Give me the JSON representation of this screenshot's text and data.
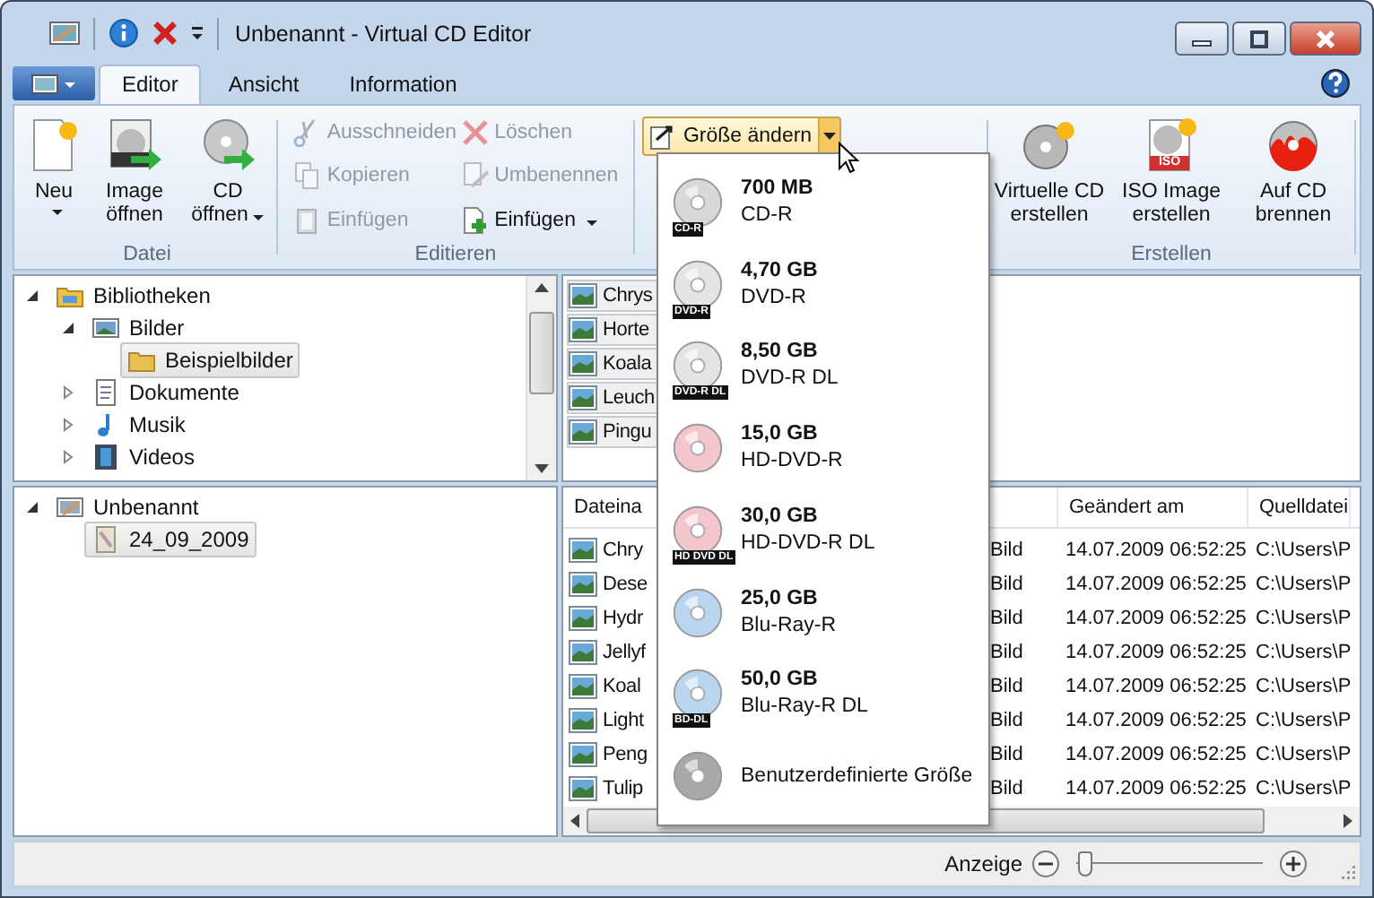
{
  "window": {
    "title": "Unbenannt - Virtual CD Editor"
  },
  "tabs": [
    {
      "label": "Editor",
      "selected": true
    },
    {
      "label": "Ansicht",
      "selected": false
    },
    {
      "label": "Information",
      "selected": false
    }
  ],
  "ribbon": {
    "datei": {
      "label": "Datei",
      "buttons": [
        {
          "kind": "new",
          "label": "Neu",
          "dropdown": true
        },
        {
          "kind": "image",
          "label": "Image öffnen",
          "dropdown": false
        },
        {
          "kind": "cd",
          "label": "CD öffnen",
          "dropdown": true
        }
      ]
    },
    "editieren": {
      "label": "Editieren",
      "buttons": [
        {
          "kind": "cut",
          "label": "Ausschneiden",
          "disabled": true,
          "dropdown": false
        },
        {
          "kind": "delete",
          "label": "Löschen",
          "disabled": true,
          "dropdown": false
        },
        {
          "kind": "copy",
          "label": "Kopieren",
          "disabled": true,
          "dropdown": false
        },
        {
          "kind": "rename",
          "label": "Umbenennen",
          "disabled": true,
          "dropdown": false
        },
        {
          "kind": "paste",
          "label": "Einfügen",
          "disabled": true,
          "dropdown": false
        },
        {
          "kind": "add",
          "label": "Einfügen",
          "disabled": false,
          "dropdown": true
        }
      ]
    },
    "resize": {
      "label": "Größe ändern",
      "expanded": true
    },
    "erstellen": {
      "label": "Erstellen",
      "buttons": [
        {
          "kind": "virtual",
          "label": "Virtuelle CD erstellen"
        },
        {
          "kind": "iso",
          "label": "ISO Image erstellen",
          "badge": "ISO"
        },
        {
          "kind": "burn",
          "label": "Auf CD brennen"
        }
      ]
    }
  },
  "size_menu": [
    {
      "kind": "cd",
      "size": "700 MB",
      "label": "CD-R",
      "badge": "CD-R"
    },
    {
      "kind": "dvd",
      "size": "4,70 GB",
      "label": "DVD-R",
      "badge": "DVD-R"
    },
    {
      "kind": "dvd",
      "size": "8,50 GB",
      "label": "DVD-R DL",
      "badge": "DVD-R DL"
    },
    {
      "kind": "hddvd",
      "size": "15,0 GB",
      "label": "HD-DVD-R"
    },
    {
      "kind": "hddvd",
      "size": "30,0 GB",
      "label": "HD-DVD-R DL",
      "badge": "HD DVD DL"
    },
    {
      "kind": "bluray",
      "size": "25,0 GB",
      "label": "Blu-Ray-R"
    },
    {
      "kind": "bluray",
      "size": "50,0 GB",
      "label": "Blu-Ray-R DL",
      "badge": "BD-DL"
    },
    {
      "kind": "custom",
      "label": "Benutzerdefinierte Größe"
    }
  ],
  "library_tree": [
    {
      "kind": "library",
      "label": "Bibliotheken",
      "expanded": true,
      "selected": false,
      "children": [
        {
          "kind": "pictures",
          "label": "Bilder",
          "expanded": true,
          "selected": false,
          "children": [
            {
              "kind": "folder",
              "label": "Beispielbilder",
              "selected": true
            }
          ]
        },
        {
          "kind": "documents",
          "label": "Dokumente",
          "expanded": false,
          "selected": false
        },
        {
          "kind": "music",
          "label": "Musik",
          "expanded": false,
          "selected": false
        },
        {
          "kind": "videos",
          "label": "Videos",
          "expanded": false,
          "selected": false
        }
      ]
    }
  ],
  "project_tree": [
    {
      "kind": "project",
      "label": "Unbenannt",
      "expanded": true,
      "selected": false,
      "children": [
        {
          "kind": "disc",
          "label": "24_09_2009",
          "selected": true
        }
      ]
    }
  ],
  "file_icons": [
    "Chrys",
    "Horte",
    "Koala",
    "Leuch",
    "Pingu"
  ],
  "table": {
    "columns": [
      "Dateina",
      "Geändert am",
      "Quelldatei"
    ],
    "rows": [
      {
        "name": "Chry",
        "type": "Bild",
        "modified": "14.07.2009 06:52:25",
        "source": "C:\\Users\\P"
      },
      {
        "name": "Dese",
        "type": "Bild",
        "modified": "14.07.2009 06:52:25",
        "source": "C:\\Users\\P"
      },
      {
        "name": "Hydr",
        "type": "Bild",
        "modified": "14.07.2009 06:52:25",
        "source": "C:\\Users\\P"
      },
      {
        "name": "Jellyf",
        "type": "Bild",
        "modified": "14.07.2009 06:52:25",
        "source": "C:\\Users\\P"
      },
      {
        "name": "Koal",
        "type": "Bild",
        "modified": "14.07.2009 06:52:25",
        "source": "C:\\Users\\P"
      },
      {
        "name": "Light",
        "type": "Bild",
        "modified": "14.07.2009 06:52:25",
        "source": "C:\\Users\\P"
      },
      {
        "name": "Peng",
        "type": "Bild",
        "modified": "14.07.2009 06:52:25",
        "source": "C:\\Users\\P"
      },
      {
        "name": "Tulip",
        "type": "Bild",
        "modified": "14.07.2009 06:52:25",
        "source": "C:\\Users\\P"
      }
    ]
  },
  "status_bar": {
    "zoom_label": "Anzeige",
    "zoom": {
      "level": 0.05
    }
  }
}
